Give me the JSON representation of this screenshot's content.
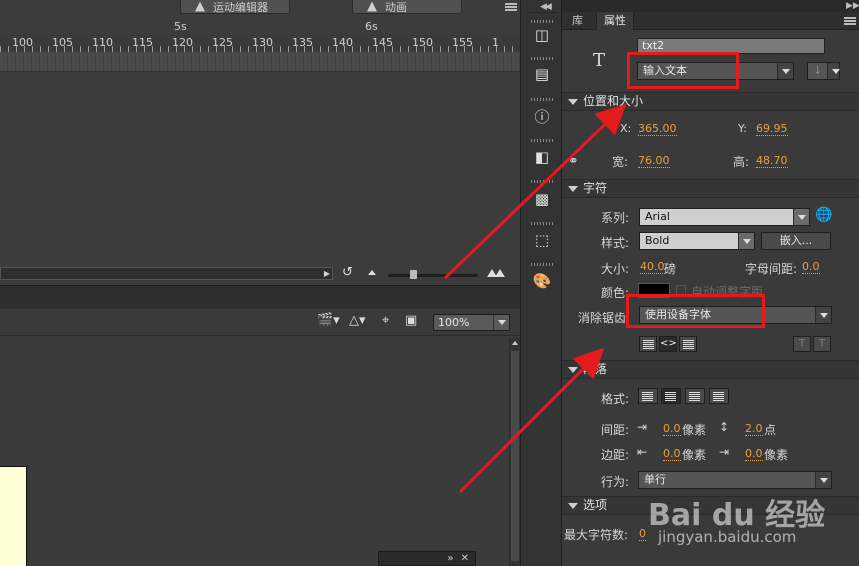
{
  "timeline": {
    "top_buttons": [
      {
        "label": "运动编辑器"
      },
      {
        "label": "动画"
      }
    ],
    "seconds": [
      "5s",
      "6s"
    ],
    "frame_numbers": [
      "100",
      "105",
      "110",
      "115",
      "120",
      "125",
      "130",
      "135",
      "140",
      "145",
      "150",
      "155",
      "1"
    ]
  },
  "stage_toolbar": {
    "zoom": "100%"
  },
  "dock": {
    "icons": [
      "library-swatch-icon",
      "align-printer-icon",
      "info-icon",
      "align-icon",
      "transform-icon",
      "crop-icon",
      "color-palette-icon"
    ]
  },
  "properties": {
    "tab_library": "库",
    "tab_properties": "属性",
    "instance_icon": "T",
    "instance_name": "txt2",
    "text_type": "输入文本",
    "section_position": "位置和大小",
    "x_label": "X:",
    "x_value": "365.00",
    "y_label": "Y:",
    "y_value": "69.95",
    "width_label": "宽:",
    "width_value": "76.00",
    "height_label": "高:",
    "height_value": "48.70",
    "section_char": "字符",
    "family_label": "系列:",
    "family_value": "Arial",
    "style_label": "样式:",
    "style_value": "Bold",
    "embed_button": "嵌入...",
    "size_label": "大小:",
    "size_value": "40.0",
    "size_unit": "磅",
    "spacing_label": "字母间距:",
    "spacing_value": "0.0",
    "color_label": "颜色:",
    "auto_kern_label": "自动调整字距",
    "antialias_label": "消除锯齿:",
    "antialias_value": "使用设备字体",
    "section_paragraph": "段落",
    "format_label": "格式:",
    "spacing2_label": "间距:",
    "indent_value": "0.0",
    "indent_unit": "像素",
    "line_spacing_value": "2.0",
    "line_spacing_unit": "点",
    "margin_label": "边距:",
    "margin_left_value": "0.0",
    "margin_left_unit": "像素",
    "margin_right_value": "0.0",
    "margin_right_unit": "像素",
    "behavior_label": "行为:",
    "behavior_value": "单行",
    "section_options": "选项",
    "max_chars_label": "最大字符数:",
    "max_chars_value": "0"
  },
  "watermark": {
    "brand": "Bai du 经验",
    "url": "jingyan.baidu.com"
  },
  "colors": {
    "annotation_red": "#e31b1b",
    "value_orange": "#e8a03c",
    "stage_page": "#ffffd6"
  }
}
